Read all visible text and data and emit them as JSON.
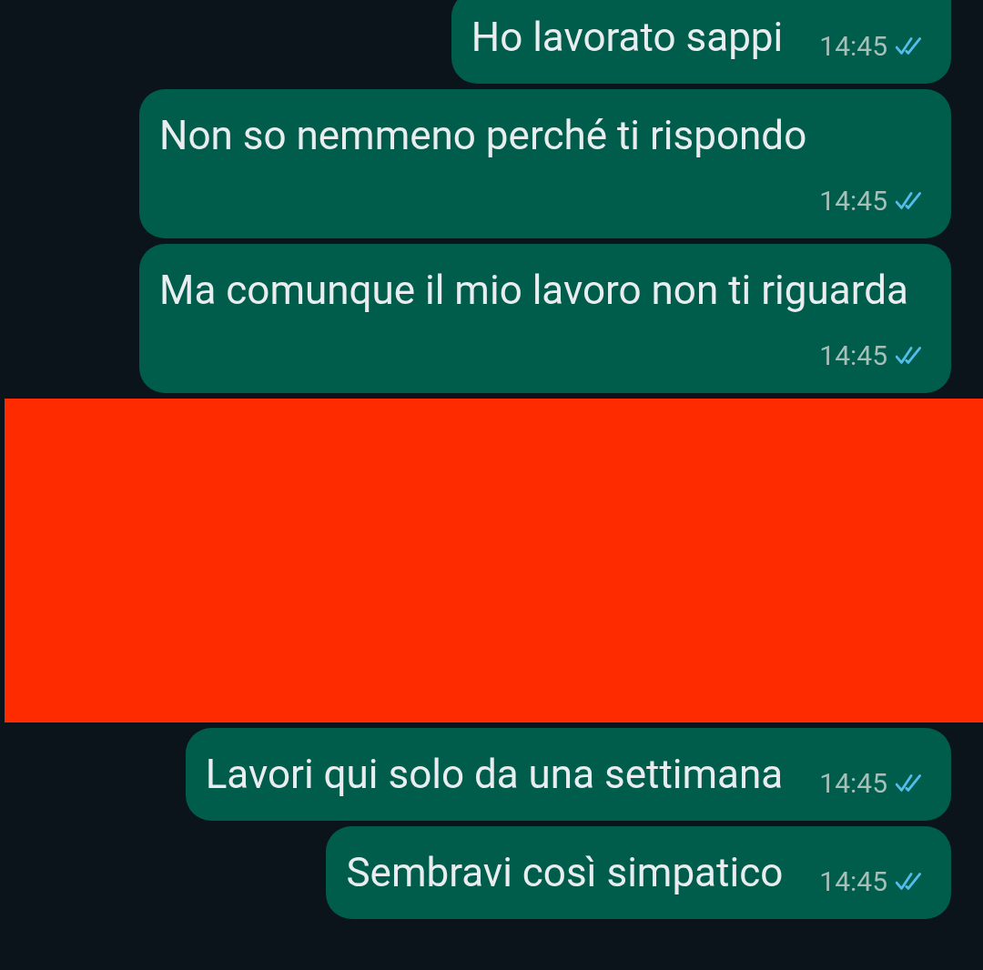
{
  "messages": [
    {
      "kind": "message",
      "text": "Ho lavorato sappi",
      "time": "14:45",
      "read": true
    },
    {
      "kind": "message",
      "text": "Non so nemmeno perché ti rispondo",
      "time": "14:45",
      "read": true
    },
    {
      "kind": "message",
      "text": "Ma comunque il mio lavoro non ti riguarda",
      "time": "14:45",
      "read": true
    },
    {
      "kind": "redacted"
    },
    {
      "kind": "message",
      "text": "Lavori qui solo da una settimana",
      "time": "14:45",
      "read": true
    },
    {
      "kind": "message",
      "text": "Sembravi così simpatico",
      "time": "14:45",
      "read": true
    }
  ]
}
